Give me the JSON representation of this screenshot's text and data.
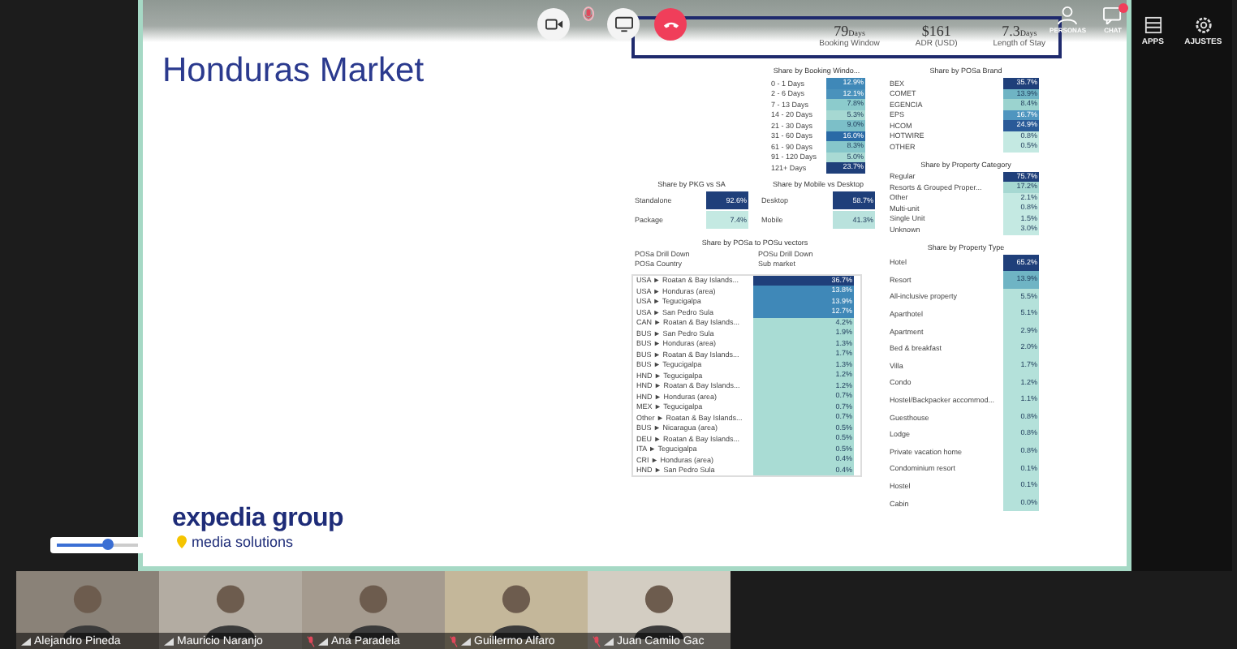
{
  "toolbar": [
    {
      "kind": "camera",
      "muted": false
    },
    {
      "kind": "mic",
      "muted": true
    },
    {
      "kind": "screen",
      "muted": false
    },
    {
      "kind": "hangup",
      "muted": false
    }
  ],
  "top_icons": [
    {
      "kind": "people",
      "label": "PERSONAS",
      "badge": false
    },
    {
      "kind": "chat",
      "label": "CHAT",
      "badge": true
    }
  ],
  "side_panel": [
    {
      "kind": "apps",
      "label": "APPS"
    },
    {
      "kind": "settings",
      "label": "AJUSTES"
    }
  ],
  "slide": {
    "title": "Honduras Market",
    "kpis": [
      {
        "value": "79",
        "unit": "Days",
        "label": "Booking Window"
      },
      {
        "value": "$161",
        "label": "ADR (USD)"
      },
      {
        "value": "7.3",
        "unit": "Days",
        "label": "Length of Stay"
      }
    ],
    "booking_window": {
      "title": "Share by Booking Windo...",
      "rows": [
        {
          "label": "0 - 1 Days",
          "value": "12.9%",
          "color": "#3f88b8"
        },
        {
          "label": "2 - 6 Days",
          "value": "12.1%",
          "color": "#4a92bc"
        },
        {
          "label": "7 - 13 Days",
          "value": "7.8%",
          "color": "#8ccbcc"
        },
        {
          "label": "14 - 20 Days",
          "value": "5.3%",
          "color": "#a6d8d2"
        },
        {
          "label": "21 - 30 Days",
          "value": "9.0%",
          "color": "#7cbfc8"
        },
        {
          "label": "31 - 60 Days",
          "value": "16.0%",
          "color": "#2a6aa6"
        },
        {
          "label": "61 - 90 Days",
          "value": "8.3%",
          "color": "#86c6ca"
        },
        {
          "label": "91 - 120 Days",
          "value": "5.0%",
          "color": "#a9dad4"
        },
        {
          "label": "121+ Days",
          "value": "23.7%",
          "color": "#1f3f7a"
        }
      ]
    },
    "brand": {
      "title": "Share by POSa Brand",
      "rows": [
        {
          "label": "BEX",
          "value": "35.7%",
          "color": "#1f3f7a"
        },
        {
          "label": "COMET",
          "value": "13.9%",
          "color": "#6fb4c4"
        },
        {
          "label": "EGENCIA",
          "value": "8.4%",
          "color": "#9bd3cf"
        },
        {
          "label": "EPS",
          "value": "16.7%",
          "color": "#4f95bf"
        },
        {
          "label": "HCOM",
          "value": "24.9%",
          "color": "#2a5a98"
        },
        {
          "label": "HOTWIRE",
          "value": "0.8%",
          "color": "#c4e9e2"
        },
        {
          "label": "OTHER",
          "value": "0.5%",
          "color": "#c4e9e2"
        }
      ]
    },
    "pkg_vs_sa": {
      "title": "Share by PKG vs SA",
      "rows": [
        {
          "label": "Standalone",
          "value": "92.6%",
          "color": "#1f3f7a"
        },
        {
          "label": "Package",
          "value": "7.4%",
          "color": "#c4e9e2"
        }
      ]
    },
    "mobile_vs_desktop": {
      "title": "Share by Mobile vs Desktop",
      "rows": [
        {
          "label": "Desktop",
          "value": "58.7%",
          "color": "#1f3f7a"
        },
        {
          "label": "Mobile",
          "value": "41.3%",
          "color": "#b9e2dd"
        }
      ]
    },
    "property_category": {
      "title": "Share by Property Category",
      "rows": [
        {
          "label": "Regular",
          "value": "75.7%",
          "color": "#1f3f7a"
        },
        {
          "label": "Resorts & Grouped Proper...",
          "value": "17.2%",
          "color": "#a6d8d2"
        },
        {
          "label": "Other",
          "value": "2.1%",
          "color": "#c4e9e2"
        },
        {
          "label": "Multi-unit",
          "value": "0.8%",
          "color": "#c4e9e2"
        },
        {
          "label": "Single Unit",
          "value": "1.5%",
          "color": "#c4e9e2"
        },
        {
          "label": "Unknown",
          "value": "3.0%",
          "color": "#c4e9e2"
        }
      ]
    },
    "posa": {
      "title": "Share by POSa to POSu vectors",
      "headers": [
        {
          "line_1": "POSa Drill Down",
          "line_2": "POSa Country"
        },
        {
          "line_1": "POSu Drill Down",
          "line_2": "Sub market"
        }
      ],
      "rows": [
        {
          "label": "USA ► Roatan & Bay Islands...",
          "value": "36.7%",
          "color": "#1f3f7a"
        },
        {
          "label": "USA ► Honduras (area)",
          "value": "13.8%",
          "color": "#3f88b8"
        },
        {
          "label": "USA ► Tegucigalpa",
          "value": "13.9%",
          "color": "#3f88b8"
        },
        {
          "label": "USA ► San Pedro Sula",
          "value": "12.7%",
          "color": "#3f88b8"
        },
        {
          "label": "CAN ► Roatan & Bay Islands...",
          "value": "4.2%",
          "color": "#a9dcd4"
        },
        {
          "label": "BUS ► San Pedro Sula",
          "value": "1.9%",
          "color": "#a9dcd4"
        },
        {
          "label": "BUS ► Honduras (area)",
          "value": "1.3%",
          "color": "#a9dcd4"
        },
        {
          "label": "BUS ► Roatan & Bay Islands...",
          "value": "1.7%",
          "color": "#a9dcd4"
        },
        {
          "label": "BUS ► Tegucigalpa",
          "value": "1.3%",
          "color": "#a9dcd4"
        },
        {
          "label": "HND ► Tegucigalpa",
          "value": "1.2%",
          "color": "#a9dcd4"
        },
        {
          "label": "HND ► Roatan & Bay Islands...",
          "value": "1.2%",
          "color": "#a9dcd4"
        },
        {
          "label": "HND ► Honduras (area)",
          "value": "0.7%",
          "color": "#a9dcd4"
        },
        {
          "label": "MEX ► Tegucigalpa",
          "value": "0.7%",
          "color": "#a9dcd4"
        },
        {
          "label": "Other ► Roatan & Bay Islands...",
          "value": "0.7%",
          "color": "#a9dcd4"
        },
        {
          "label": "BUS ► Nicaragua (area)",
          "value": "0.5%",
          "color": "#a9dcd4"
        },
        {
          "label": "DEU ► Roatan & Bay Islands...",
          "value": "0.5%",
          "color": "#a9dcd4"
        },
        {
          "label": "ITA ► Tegucigalpa",
          "value": "0.5%",
          "color": "#a9dcd4"
        },
        {
          "label": "CRI ► Honduras (area)",
          "value": "0.4%",
          "color": "#a9dcd4"
        },
        {
          "label": "HND ► San Pedro Sula",
          "value": "0.4%",
          "color": "#a9dcd4"
        }
      ]
    },
    "property_type": {
      "title": "Share by Property Type",
      "rows": [
        {
          "label": "Hotel",
          "value": "65.2%",
          "color": "#1f3f7a"
        },
        {
          "label": "Resort",
          "value": "13.9%",
          "color": "#6fb4c4"
        },
        {
          "label": "All-inclusive property",
          "value": "5.5%",
          "color": "#b4e1da"
        },
        {
          "label": "Aparthotel",
          "value": "5.1%",
          "color": "#b4e1da"
        },
        {
          "label": "Apartment",
          "value": "2.9%",
          "color": "#b4e1da"
        },
        {
          "label": "Bed & breakfast",
          "value": "2.0%",
          "color": "#b4e1da"
        },
        {
          "label": "Villa",
          "value": "1.7%",
          "color": "#b4e1da"
        },
        {
          "label": "Condo",
          "value": "1.2%",
          "color": "#b4e1da"
        },
        {
          "label": "Hostel/Backpacker accommod...",
          "value": "1.1%",
          "color": "#b4e1da"
        },
        {
          "label": "Guesthouse",
          "value": "0.8%",
          "color": "#b4e1da"
        },
        {
          "label": "Lodge",
          "value": "0.8%",
          "color": "#b4e1da"
        },
        {
          "label": "Private vacation home",
          "value": "0.8%",
          "color": "#b4e1da"
        },
        {
          "label": "Condominium resort",
          "value": "0.1%",
          "color": "#b4e1da"
        },
        {
          "label": "Hostel",
          "value": "0.1%",
          "color": "#b4e1da"
        },
        {
          "label": "Cabin",
          "value": "0.0%",
          "color": "#b4e1da"
        }
      ]
    },
    "logo": {
      "name": "expedia group",
      "tagline": "media solutions"
    }
  },
  "zoom_slider": {
    "level": 0.62
  },
  "participants": [
    {
      "name": "Alejandro Pineda",
      "muted": false
    },
    {
      "name": "Mauricio Naranjo",
      "muted": false
    },
    {
      "name": "Ana Paradela",
      "muted": true
    },
    {
      "name": "Guillermo Alfaro",
      "muted": true
    },
    {
      "name": "Juan Camilo Gac",
      "muted": true
    }
  ]
}
